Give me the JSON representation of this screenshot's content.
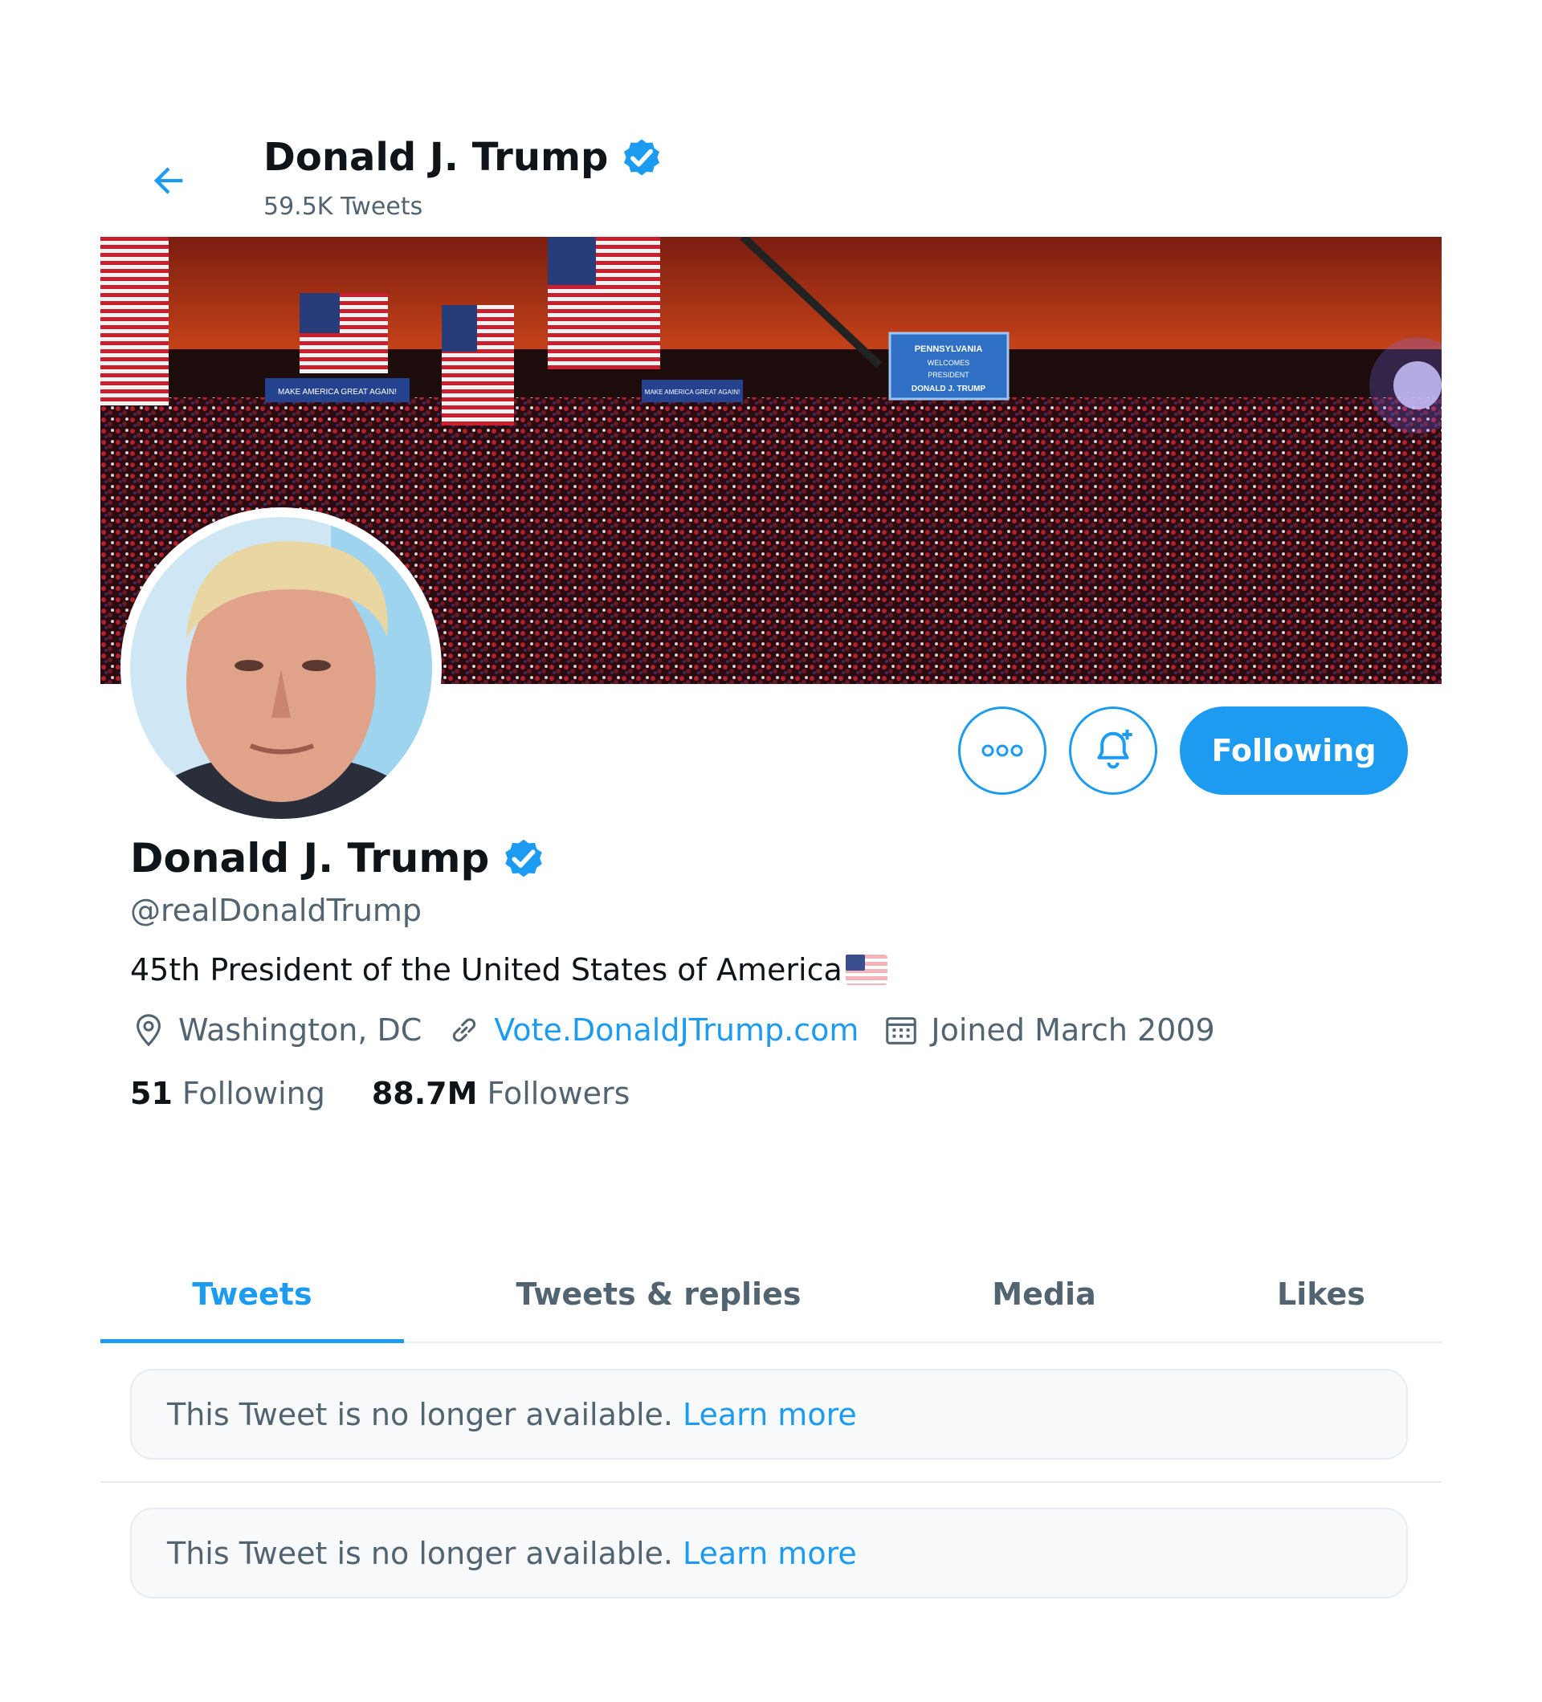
{
  "header": {
    "name": "Donald J. Trump",
    "tweet_count": "59.5K Tweets"
  },
  "profile": {
    "name": "Donald J. Trump",
    "handle": "@realDonaldTrump",
    "bio": "45th President of the United States of America",
    "location": "Washington, DC",
    "website": "Vote.DonaldJTrump.com",
    "joined": "Joined March 2009",
    "following_count": "51",
    "following_label": "Following",
    "followers_count": "88.7M",
    "followers_label": "Followers"
  },
  "banner_signs": {
    "sign_left": "MAKE AMERICA GREAT AGAIN!",
    "sign_right": "MAKE AMERICA GREAT AGAIN!",
    "screen_line1": "PENNSYLVANIA",
    "screen_line2": "WELCOMES",
    "screen_line3": "PRESIDENT",
    "screen_line4": "DONALD J. TRUMP"
  },
  "actions": {
    "following_label": "Following"
  },
  "tabs": [
    {
      "label": "Tweets"
    },
    {
      "label": "Tweets & replies"
    },
    {
      "label": "Media"
    },
    {
      "label": "Likes"
    }
  ],
  "notices": [
    {
      "text": "This Tweet is no longer available.",
      "link": "Learn more"
    },
    {
      "text": "This Tweet is no longer available.",
      "link": "Learn more"
    }
  ],
  "colors": {
    "accent": "#1d9bf0",
    "text_primary": "#0f1419",
    "text_secondary": "#536471",
    "border": "#e6ecf0"
  },
  "icons": [
    "back-arrow-icon",
    "verified-badge-icon",
    "more-icon",
    "notification-bell-icon",
    "location-icon",
    "link-icon",
    "calendar-icon",
    "us-flag-icon"
  ]
}
